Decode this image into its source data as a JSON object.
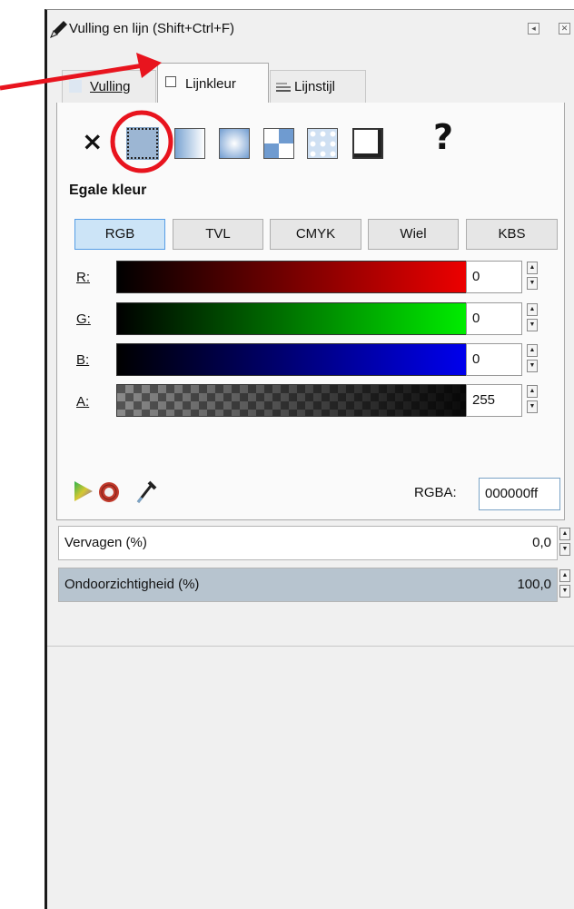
{
  "window": {
    "title": "Vulling en lijn (Shift+Ctrl+F)"
  },
  "tabs": [
    {
      "label": "Vulling",
      "active": false
    },
    {
      "label": "Lijnkleur",
      "active": true
    },
    {
      "label": "Lijnstijl",
      "active": false
    }
  ],
  "paint_types": [
    "none",
    "flat-color",
    "linear-gradient",
    "radial-gradient",
    "mesh-gradient",
    "pattern",
    "swatch",
    "unset"
  ],
  "paint_none_glyph": "×",
  "paint_unset_glyph": "?",
  "section_heading": "Egale kleur",
  "color_modes": [
    {
      "label": "RGB",
      "active": true
    },
    {
      "label": "TVL",
      "active": false
    },
    {
      "label": "CMYK",
      "active": false
    },
    {
      "label": "Wiel",
      "active": false
    },
    {
      "label": "KBS",
      "active": false
    }
  ],
  "channels": [
    {
      "label": "R:",
      "value": "0",
      "color": "#ff0000"
    },
    {
      "label": "G:",
      "value": "0",
      "color": "#00ff00"
    },
    {
      "label": "B:",
      "value": "0",
      "color": "#0000ff"
    },
    {
      "label": "A:",
      "value": "255",
      "color": "#000000"
    }
  ],
  "rgba": {
    "label": "RGBA:",
    "value": "000000ff"
  },
  "blur": {
    "label": "Vervagen (%)",
    "value": "0,0"
  },
  "opacity": {
    "label": "Ondoorzichtigheid (%)",
    "value": "100,0"
  },
  "annotation": {
    "arrow_color": "#e8141e",
    "circle_color": "#e8141e"
  }
}
